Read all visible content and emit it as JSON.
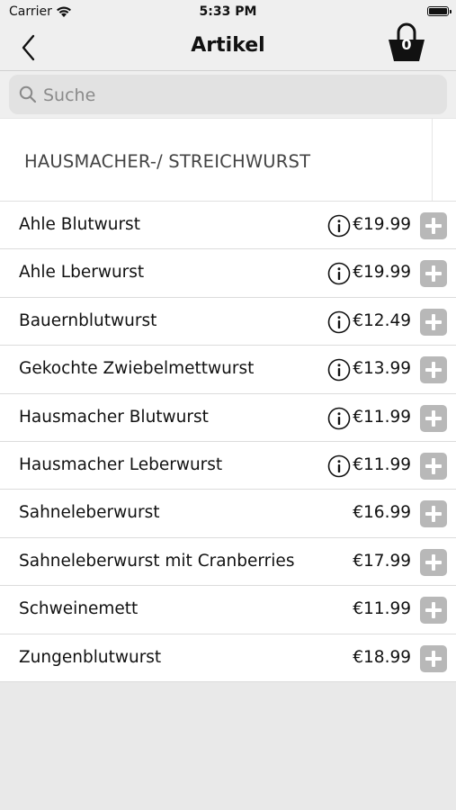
{
  "status_bar": {
    "carrier": "Carrier",
    "time": "5:33 PM"
  },
  "nav": {
    "title": "Artikel",
    "cart_count": "0",
    "back_icon": "chevron-left-icon",
    "cart_icon": "shopping-basket-icon"
  },
  "search": {
    "placeholder": "Suche",
    "value": ""
  },
  "category": {
    "title": "HAUSMACHER-/ STREICHWURST"
  },
  "items": [
    {
      "name": "Ahle Blutwurst",
      "price": "€19.99",
      "has_info": true
    },
    {
      "name": "Ahle Lberwurst",
      "price": "€19.99",
      "has_info": true
    },
    {
      "name": "Bauernblutwurst",
      "price": "€12.49",
      "has_info": true
    },
    {
      "name": "Gekochte Zwiebelmettwurst",
      "price": "€13.99",
      "has_info": true
    },
    {
      "name": "Hausmacher Blutwurst",
      "price": "€11.99",
      "has_info": true
    },
    {
      "name": "Hausmacher Leberwurst",
      "price": "€11.99",
      "has_info": true
    },
    {
      "name": "Sahneleberwurst",
      "price": "€16.99",
      "has_info": false
    },
    {
      "name": "Sahneleberwurst mit Cranberries",
      "price": "€17.99",
      "has_info": false
    },
    {
      "name": "Schweinemett",
      "price": "€11.99",
      "has_info": false
    },
    {
      "name": "Zungenblutwurst",
      "price": "€18.99",
      "has_info": false
    }
  ],
  "colors": {
    "nav_background": "#efefef",
    "add_button": "#b8b8b8",
    "page_background": "#e9e9e9"
  }
}
